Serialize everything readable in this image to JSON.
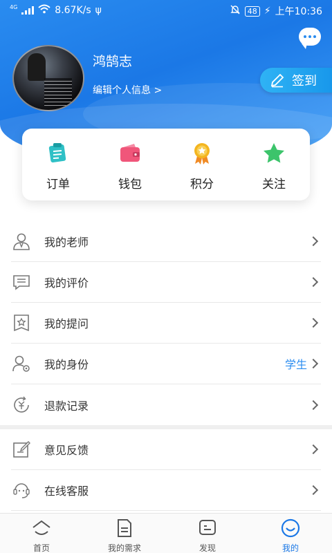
{
  "status_bar": {
    "network_tag": "4G",
    "speed": "8.67K/s",
    "usb_glyph": "ψ",
    "battery": "48",
    "time": "上午10:36"
  },
  "profile": {
    "name": "鸿鹄志",
    "edit_label": "编辑个人信息 >"
  },
  "signin": {
    "label": "签到"
  },
  "quick_actions": [
    {
      "label": "订单",
      "icon": "order-icon"
    },
    {
      "label": "钱包",
      "icon": "wallet-icon"
    },
    {
      "label": "积分",
      "icon": "points-medal-icon"
    },
    {
      "label": "关注",
      "icon": "star-icon"
    }
  ],
  "menu": [
    {
      "label": "我的老师",
      "icon": "teacher-icon",
      "value": ""
    },
    {
      "label": "我的评价",
      "icon": "comment-icon",
      "value": ""
    },
    {
      "label": "我的提问",
      "icon": "question-icon",
      "value": ""
    },
    {
      "label": "我的身份",
      "icon": "identity-icon",
      "value": "学生"
    },
    {
      "label": "退款记录",
      "icon": "refund-icon",
      "value": ""
    },
    {
      "label": "意见反馈",
      "icon": "feedback-icon",
      "value": ""
    },
    {
      "label": "在线客服",
      "icon": "customer-service-icon",
      "value": ""
    }
  ],
  "tabbar": [
    {
      "label": "首页",
      "icon": "home-icon"
    },
    {
      "label": "我的需求",
      "icon": "document-icon"
    },
    {
      "label": "发现",
      "icon": "discover-icon"
    },
    {
      "label": "我的",
      "icon": "profile-smile-icon"
    }
  ],
  "colors": {
    "primary": "#1b78e6",
    "accent_blue": "#2a8cf0",
    "wallet": "#f0567a",
    "points": "#f4b51f",
    "star": "#3cc46b",
    "order": "#2fc0c6"
  }
}
